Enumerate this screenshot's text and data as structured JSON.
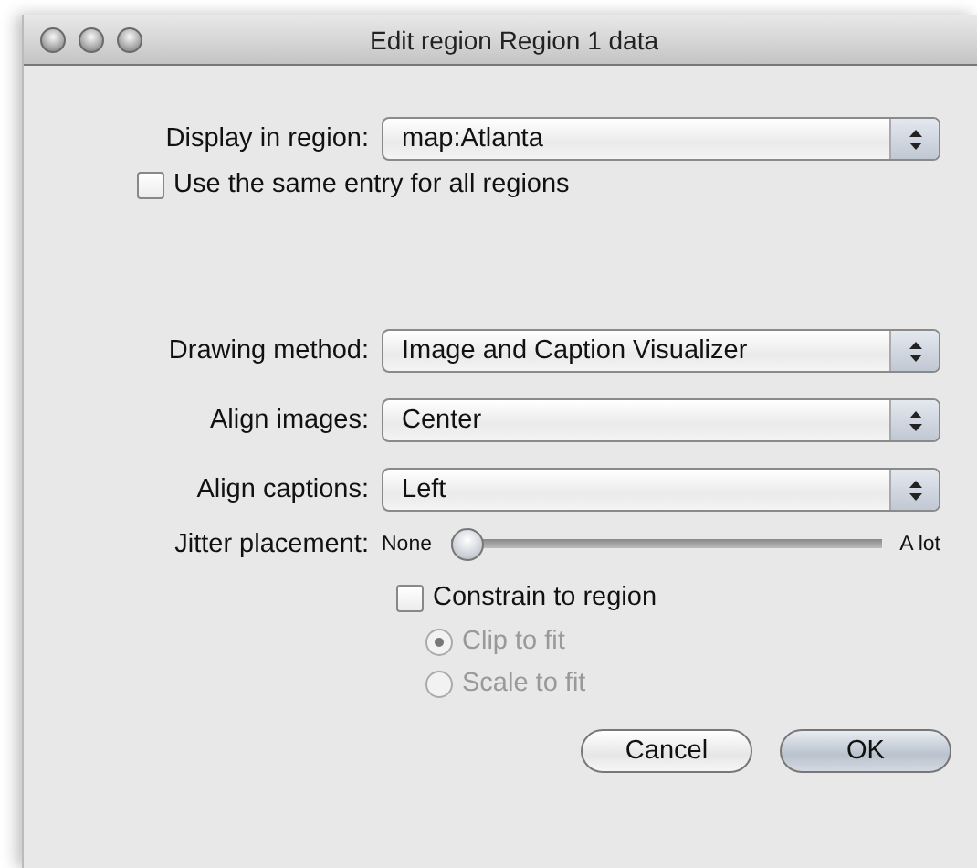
{
  "window": {
    "title": "Edit region Region 1 data"
  },
  "display_in_region": {
    "label": "Display in region:",
    "value": "map:Atlanta"
  },
  "same_entry": {
    "label": "Use the same entry for all regions",
    "checked": false
  },
  "popups": [
    {
      "label": "Drawing method:",
      "value": "Image and Caption Visualizer"
    },
    {
      "label": "Align images:",
      "value": "Center"
    },
    {
      "label": "Align captions:",
      "value": "Left"
    }
  ],
  "jitter": {
    "label": "Jitter placement:",
    "min_label": "None",
    "max_label": "A lot",
    "level": 0
  },
  "constrain": {
    "label": "Constrain to region",
    "checked": false
  },
  "fit_options": [
    {
      "label": "Clip to fit",
      "selected": true,
      "disabled": true
    },
    {
      "label": "Scale to fit",
      "selected": false,
      "disabled": true
    }
  ],
  "buttons": [
    {
      "label": "Cancel",
      "kind": "cancel"
    },
    {
      "label": "OK",
      "kind": "default"
    }
  ]
}
